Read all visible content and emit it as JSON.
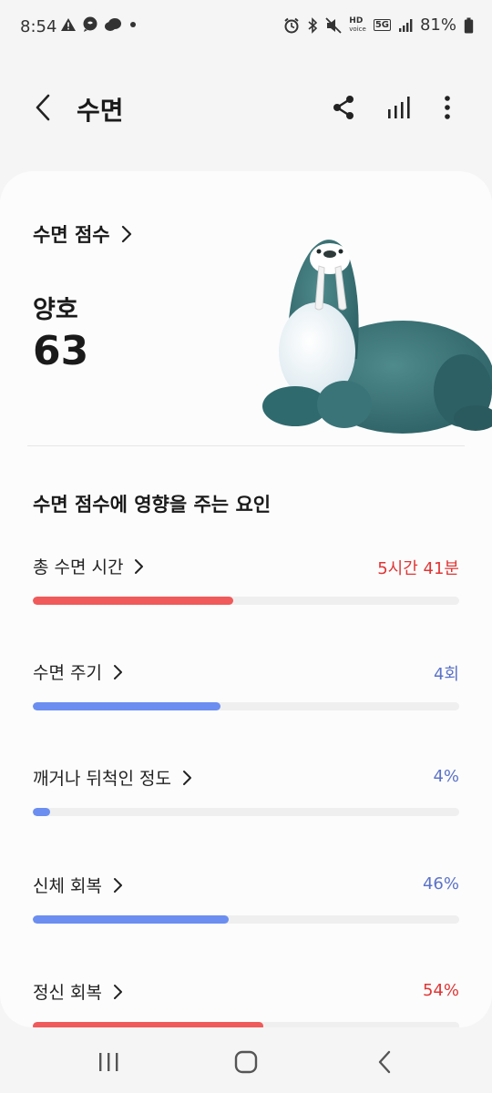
{
  "status": {
    "time": "8:54",
    "network_hd": "HD",
    "network_voice": "voice",
    "network_5g": "5G",
    "battery": "81%"
  },
  "app_bar": {
    "title": "수면",
    "icons": [
      "back-icon",
      "share-icon",
      "bar-chart-icon",
      "more-vert-icon"
    ]
  },
  "score": {
    "link_label": "수면 점수",
    "rating": "양호",
    "value": "63"
  },
  "factors_title": "수면 점수에 영향을 주는 요인",
  "colors": {
    "red": "#f05a5a",
    "red_text": "#e03535",
    "blue": "#6b8ef0",
    "blue_text": "#5b72c8",
    "track": "#efefef"
  },
  "factors": [
    {
      "label": "총 수면 시간",
      "value": "5시간 41분",
      "level": 0.47,
      "color": "red"
    },
    {
      "label": "수면 주기",
      "value": "4회",
      "level": 0.44,
      "color": "blue"
    },
    {
      "label": "깨거나 뒤척인 정도",
      "value": "4%",
      "level": 0.04,
      "color": "blue"
    },
    {
      "label": "신체 회복",
      "value": "46%",
      "level": 0.46,
      "color": "blue"
    },
    {
      "label": "정신 회복",
      "value": "54%",
      "level": 0.54,
      "color": "red"
    }
  ],
  "nav": {
    "icons": [
      "recent-apps-icon",
      "home-icon",
      "back-nav-icon"
    ]
  }
}
